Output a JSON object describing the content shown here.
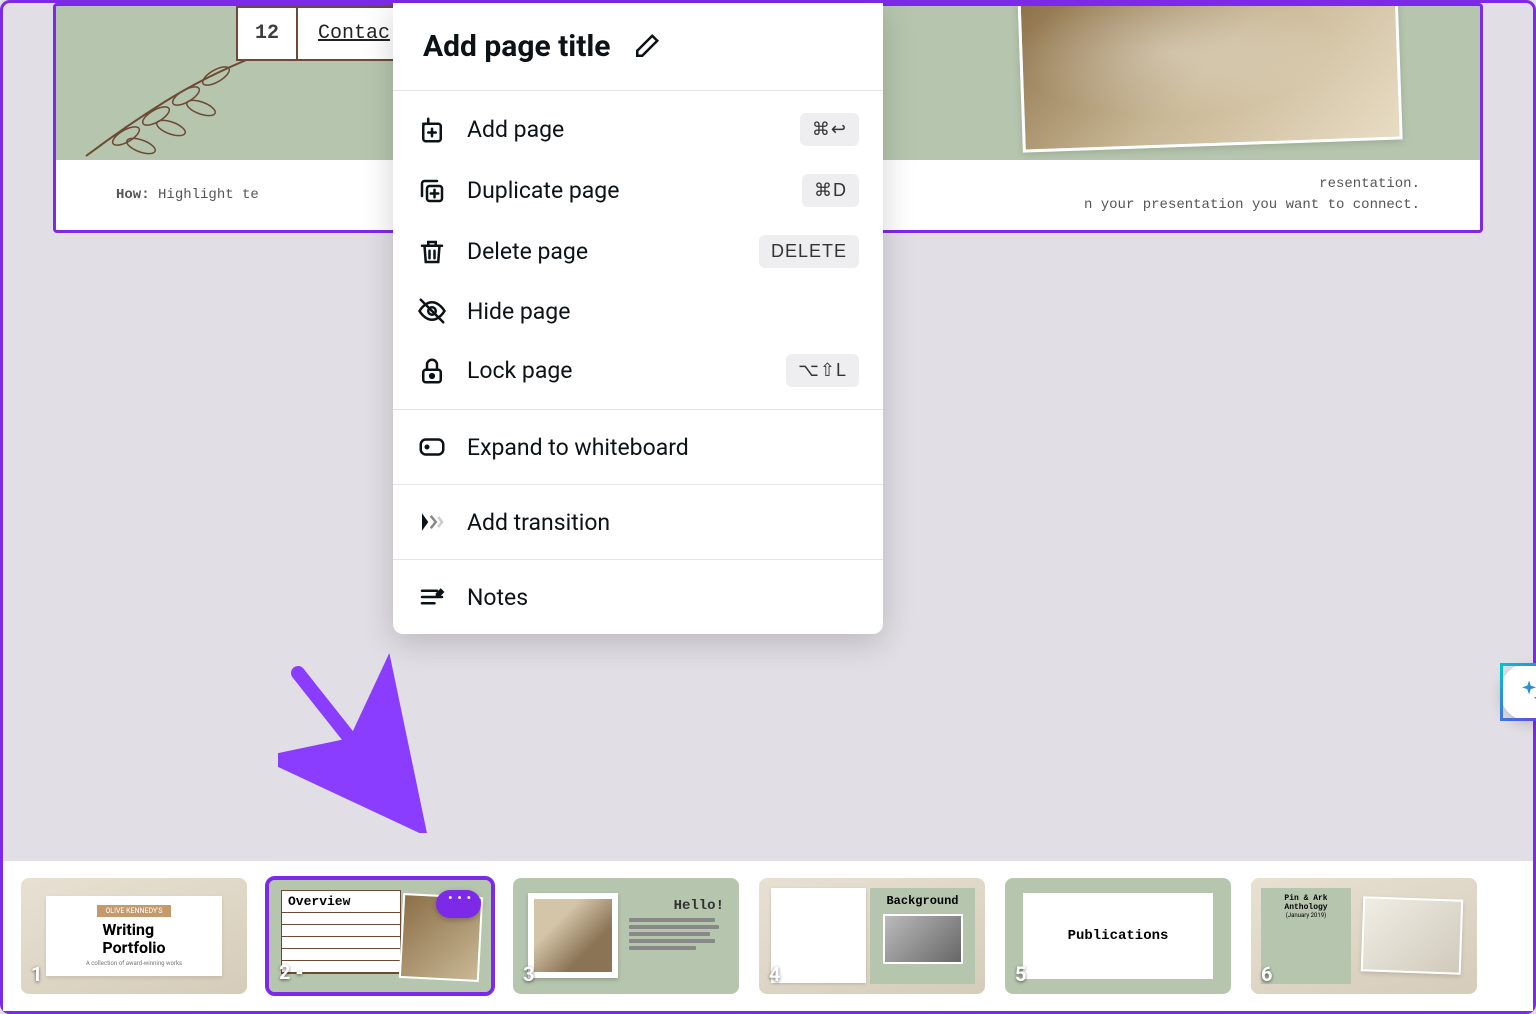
{
  "slide": {
    "row_num": "12",
    "row_text": "Contac",
    "footer_left_label": "How:",
    "footer_left_text": "Highlight te",
    "footer_right_line1": "resentation.",
    "footer_right_line2": "n your presentation  you want to connect."
  },
  "menu": {
    "title": "Add page title",
    "items": [
      {
        "label": "Add page",
        "shortcut": "⌘↩"
      },
      {
        "label": "Duplicate page",
        "shortcut": "⌘D"
      },
      {
        "label": "Delete page",
        "shortcut": "DELETE"
      },
      {
        "label": "Hide page",
        "shortcut": ""
      },
      {
        "label": "Lock page",
        "shortcut": "⌥⇧L"
      },
      {
        "label": "Expand to whiteboard",
        "shortcut": ""
      },
      {
        "label": "Add transition",
        "shortcut": ""
      },
      {
        "label": "Notes",
        "shortcut": ""
      }
    ]
  },
  "thumbnails": [
    {
      "num": "1",
      "title": "Writing\nPortfolio",
      "tag": "OLIVE KENNEDY'S",
      "sub": "A collection of award-winning works",
      "selected": false
    },
    {
      "num": "2 -",
      "title": "Overview",
      "selected": true
    },
    {
      "num": "3",
      "title": "Hello!",
      "selected": false
    },
    {
      "num": "4",
      "title": "Background",
      "selected": false
    },
    {
      "num": "5",
      "title": "Publications",
      "selected": false
    },
    {
      "num": "6",
      "title": "Pin & Ark Anthology",
      "sub": "(January 2019)",
      "selected": false
    }
  ]
}
